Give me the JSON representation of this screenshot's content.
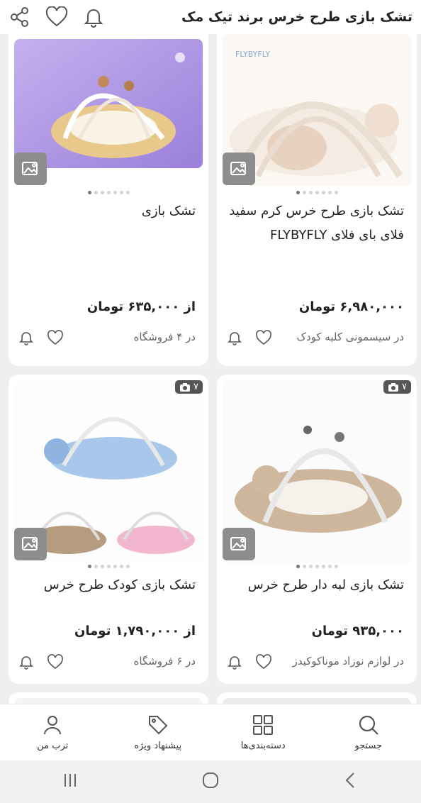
{
  "header": {
    "title": "تشک بازی طرح خرس برند تیک مک",
    "icons": [
      "share-icon",
      "heart-icon",
      "bell-icon"
    ]
  },
  "products": [
    {
      "name": "تشک بازی",
      "price": "از ۶۳۵,۰۰۰ تومان",
      "seller": "در ۴ فروشگاه",
      "image_count": "",
      "image_colors": [
        "#b9a3e6",
        "#9f83dc"
      ]
    },
    {
      "name": "تشک بازی طرح خرس کرم سفید فلای بای فلای FLYBYFLY",
      "price": "۶,۹۸۰,۰۰۰ تومان",
      "seller": "در سیسمونی کلبه کودک",
      "image_count": "",
      "image_colors": [
        "#f7efe7",
        "#e9d7c6"
      ]
    },
    {
      "name": "تشک بازی کودک طرح خرس",
      "price": "از ۱,۷۹۰,۰۰۰ تومان",
      "seller": "در ۶ فروشگاه",
      "image_count": "۷",
      "image_colors": [
        "#f4f7fb",
        "#cfdff0"
      ]
    },
    {
      "name": "تشک بازی لبه دار طرح خرس",
      "price": "۹۳۵,۰۰۰ تومان",
      "seller": "در لوازم نوزاد موناکوکیدز",
      "image_count": "۷",
      "image_colors": [
        "#f6f3ef",
        "#d6c3ab"
      ]
    }
  ],
  "bottom_nav": [
    {
      "label": "ترب من",
      "icon": "user-icon"
    },
    {
      "label": "پیشنهاد ویژه",
      "icon": "tag-icon"
    },
    {
      "label": "دسته‌بندی‌ها",
      "icon": "grid-icon"
    },
    {
      "label": "جستجو",
      "icon": "search-icon"
    }
  ],
  "system_bar": [
    "recent-apps-icon",
    "home-icon",
    "back-icon"
  ]
}
